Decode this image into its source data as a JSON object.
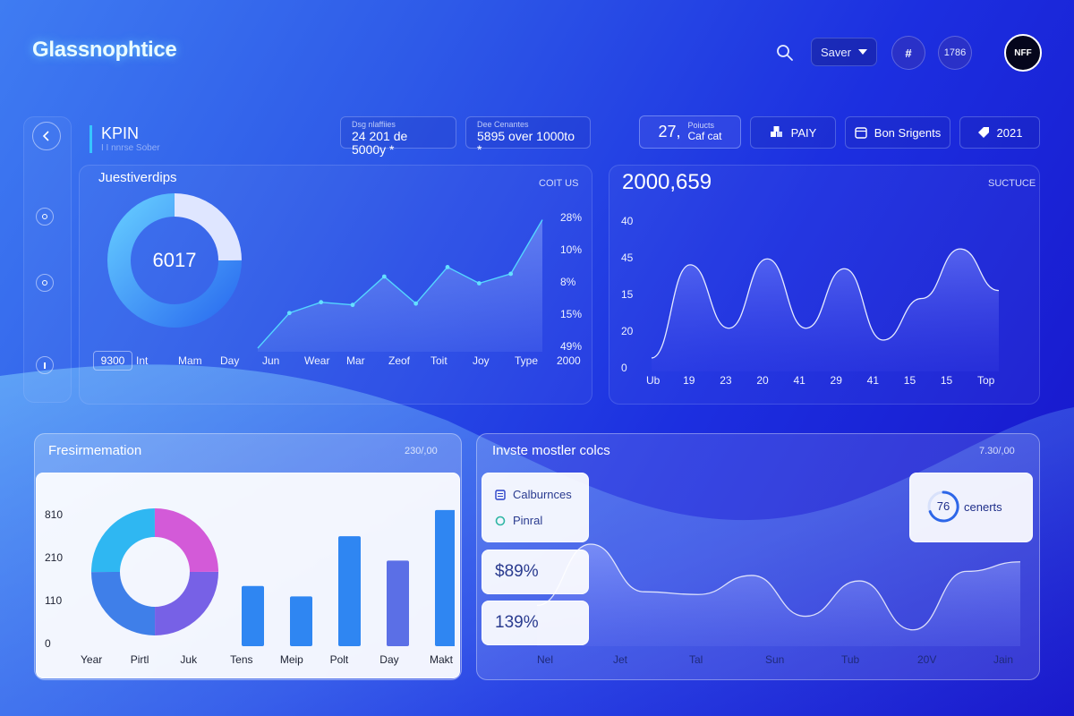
{
  "app": {
    "title": "Glassnophtice"
  },
  "header": {
    "select_label": "Saver",
    "circle_one": "#",
    "circle_two": "1786",
    "avatar_text": "NFF"
  },
  "kpi": {
    "title": "KPIN",
    "subtitle": "I I nnrse Sober"
  },
  "stats": [
    {
      "small": "Dsg nlaffiies",
      "big": "24 201 de 5000y *"
    },
    {
      "small": "Dee Cenantes",
      "big": "5895 over 1000to *"
    }
  ],
  "pills": [
    {
      "big": "27,",
      "small_top": "Poiucts",
      "small": "Caf cat"
    },
    {
      "label": "PAIY"
    },
    {
      "label": "Bon Srigents"
    },
    {
      "label": "2021"
    }
  ],
  "panel_a": {
    "title": "Juestiverdips",
    "right": "COIT US",
    "donut_value": "6017",
    "badge": "9300",
    "y_labels": [
      "28%",
      "10%",
      "8%",
      "15%",
      "49%"
    ],
    "x_labels": [
      "Int",
      "Mam",
      "Day",
      "Jun",
      "Wear",
      "Mar",
      "Zeof",
      "Toit",
      "Joy",
      "Type",
      "2000"
    ]
  },
  "panel_b": {
    "title": "2000,659",
    "right": "SUCTUCE",
    "y_labels": [
      "40",
      "45",
      "15",
      "20",
      "0"
    ],
    "x_labels": [
      "Ub",
      "19",
      "23",
      "20",
      "41",
      "29",
      "41",
      "15",
      "15",
      "Top"
    ]
  },
  "panel_c": {
    "title": "Fresirmemation",
    "right": "230/,00",
    "y_labels": [
      "810",
      "210",
      "110",
      "0"
    ],
    "x_labels": [
      "Year",
      "Pirtl",
      "Juk",
      "Tens",
      "Meip",
      "Polt",
      "Day",
      "Makt"
    ]
  },
  "panel_d": {
    "title": "Invste mostler colcs",
    "right": "7.30/,00",
    "legend_one": "Calburnces",
    "legend_two": "Pinral",
    "metric_one": "$89%",
    "metric_two": "139%",
    "ring_value": "76",
    "ring_label": "cenerts",
    "x_labels": [
      "Nel",
      "Jet",
      "Tal",
      "Sun",
      "Tub",
      "20V",
      "Jain"
    ]
  },
  "chart_data": [
    {
      "type": "pie",
      "title": "Juestiverdips",
      "slices": [
        {
          "name": "light",
          "value": 25,
          "color": "#dfe6ff"
        },
        {
          "name": "blue",
          "value": 75,
          "color": "#3a9df5"
        }
      ],
      "center_label": "6017"
    },
    {
      "type": "area",
      "series": [
        {
          "values": [
            0,
            26,
            34,
            32,
            53,
            33,
            60,
            48,
            55,
            95
          ]
        }
      ],
      "ylim": [
        0,
        100
      ],
      "categories": [
        "Jun",
        "Wear",
        "Mar",
        "Zeof",
        "Toit",
        "Joy",
        "Type"
      ]
    },
    {
      "type": "area",
      "title": "2000,659",
      "series": [
        {
          "values": [
            5,
            52,
            20,
            55,
            20,
            50,
            14,
            35,
            60,
            39
          ]
        }
      ],
      "ylim": [
        0,
        70
      ],
      "categories": [
        "Ub",
        "19",
        "23",
        "20",
        "41",
        "29",
        "41",
        "15",
        "15",
        "Top"
      ]
    },
    {
      "type": "pie",
      "slices": [
        {
          "name": "magenta",
          "value": 25,
          "color": "#d35ad8"
        },
        {
          "name": "violet",
          "value": 25,
          "color": "#7761e6"
        },
        {
          "name": "blue",
          "value": 25,
          "color": "#3f7fe9"
        },
        {
          "name": "cyan",
          "value": 25,
          "color": "#2fb7f2"
        }
      ]
    },
    {
      "type": "bar",
      "title": "Fresirmemation",
      "categories": [
        "Tens",
        "Meip",
        "Polt",
        "Day",
        "Makt"
      ],
      "values": [
        345,
        285,
        630,
        490,
        780
      ],
      "ylim": [
        0,
        810
      ],
      "colors": [
        "#2f86f2",
        "#2f86f2",
        "#2f86f2",
        "#5b6fe6",
        "#2f86f2"
      ]
    },
    {
      "type": "area",
      "title": "Invste mostler colcs",
      "series": [
        {
          "values": [
            30,
            75,
            40,
            38,
            52,
            22,
            48,
            12,
            55,
            62
          ]
        }
      ],
      "ylim": [
        0,
        100
      ],
      "categories": [
        "Nel",
        "Jet",
        "Tal",
        "Sun",
        "Tub",
        "20V",
        "Jain"
      ]
    }
  ]
}
